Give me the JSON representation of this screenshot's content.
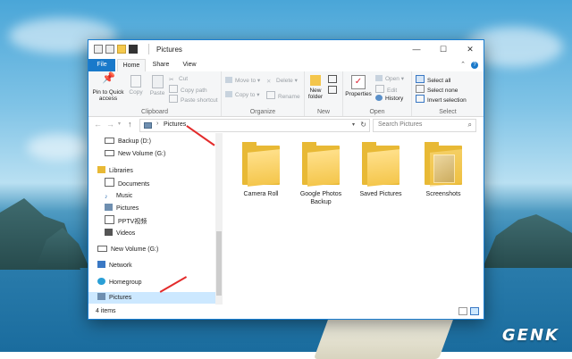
{
  "window": {
    "title": "Pictures",
    "tabs": [
      "File",
      "Home",
      "Share",
      "View"
    ],
    "controls": {
      "minimize": "—",
      "maximize": "☐",
      "close": "✕"
    }
  },
  "ribbon": {
    "clipboard": {
      "pin": "Pin to Quick access",
      "copy": "Copy",
      "paste": "Paste",
      "cut": "Cut",
      "copy_path": "Copy path",
      "paste_shortcut": "Paste shortcut",
      "label": "Clipboard"
    },
    "organize": {
      "move_to": "Move to",
      "copy_to": "Copy to",
      "delete": "Delete",
      "rename": "Rename",
      "label": "Organize"
    },
    "new": {
      "new_folder": "New folder",
      "label": "New"
    },
    "open": {
      "properties": "Properties",
      "open": "Open",
      "edit": "Edit",
      "history": "History",
      "label": "Open"
    },
    "select": {
      "select_all": "Select all",
      "select_none": "Select none",
      "invert": "Invert selection",
      "label": "Select"
    }
  },
  "address": {
    "crumb": "Pictures",
    "search_placeholder": "Search Pictures"
  },
  "nav": {
    "items": [
      {
        "label": "Backup (D:)"
      },
      {
        "label": "New Volume (G:)"
      },
      {
        "label": "Libraries"
      },
      {
        "label": "Documents"
      },
      {
        "label": "Music"
      },
      {
        "label": "Pictures"
      },
      {
        "label": "PPTV视频"
      },
      {
        "label": "Videos"
      },
      {
        "label": "New Volume (G:)"
      },
      {
        "label": "Network"
      },
      {
        "label": "Homegroup"
      },
      {
        "label": "Pictures"
      }
    ]
  },
  "folders": [
    {
      "name": "Camera Roll"
    },
    {
      "name": "Google Photos Backup"
    },
    {
      "name": "Saved Pictures"
    },
    {
      "name": "Screenshots"
    }
  ],
  "status": {
    "count": "4 items"
  },
  "watermark": "GENK",
  "colors": {
    "accent": "#1979ca",
    "folder": "#f4c64c",
    "annotation": "#e32b2b",
    "selection": "#cce8ff"
  }
}
